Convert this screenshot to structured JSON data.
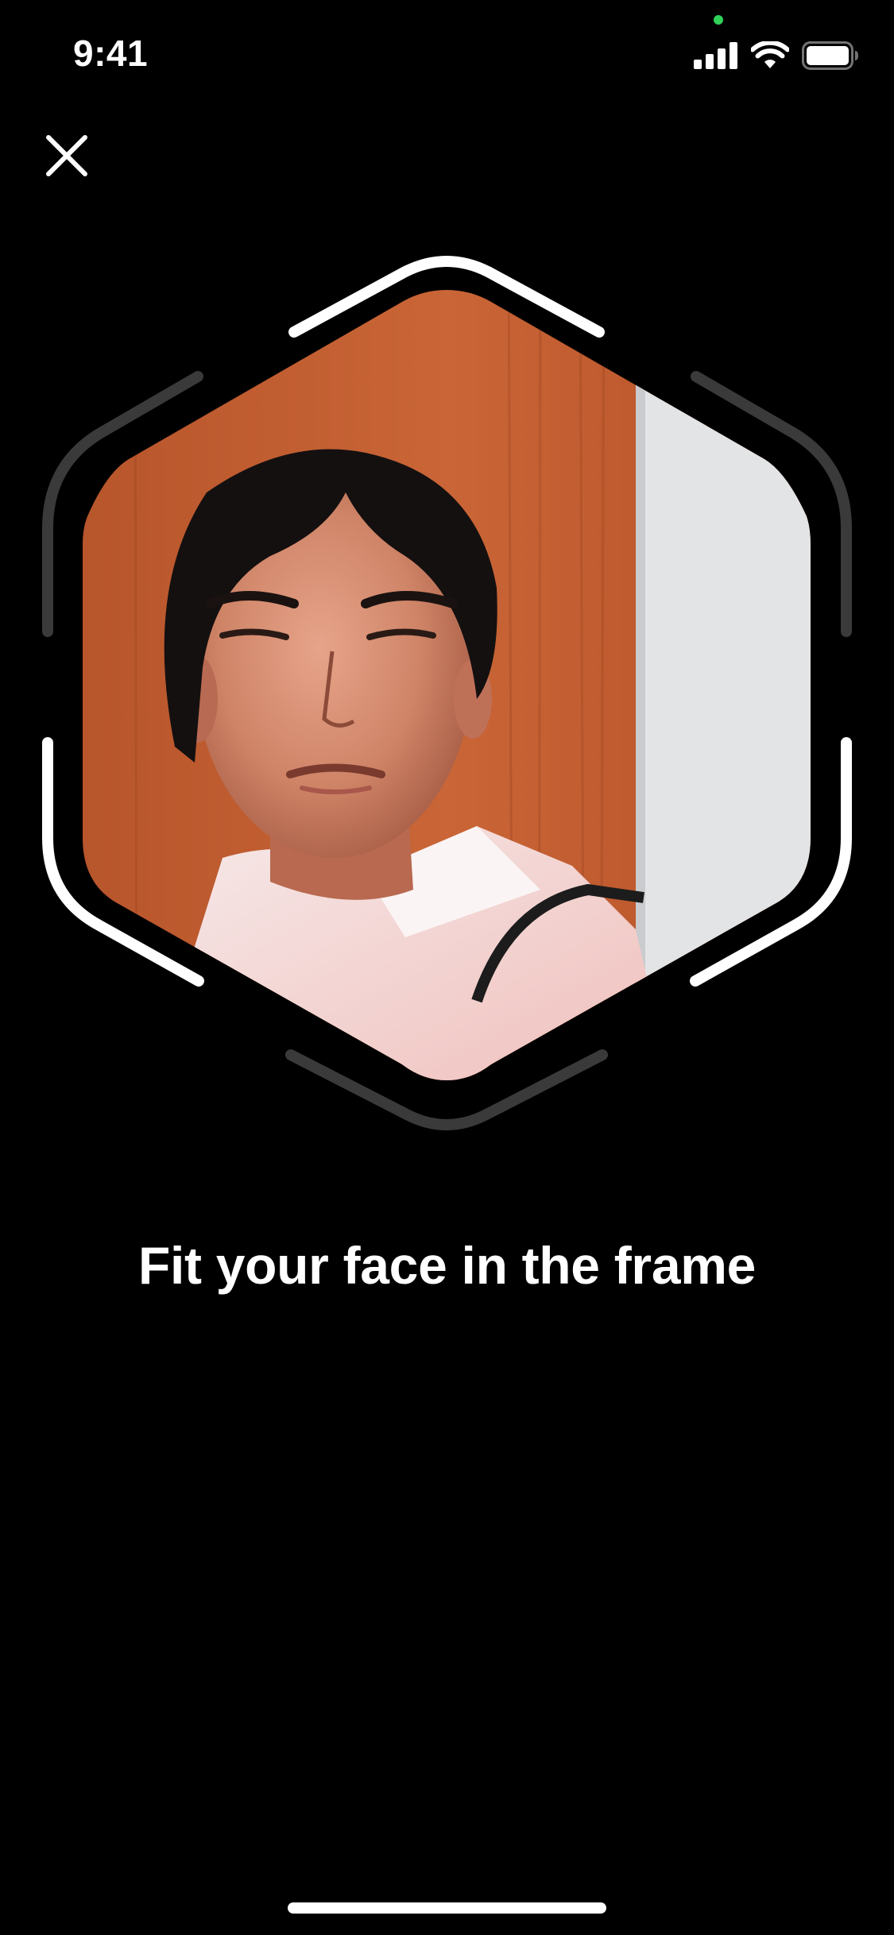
{
  "status_bar": {
    "time": "9:41"
  },
  "close_button": {
    "icon": "close-icon"
  },
  "camera": {
    "overlay_shape": "hexagon",
    "frame_color": "#ffffff",
    "inactive_frame_color": "#3a3a3a"
  },
  "instruction": {
    "text": "Fit your face in the frame"
  },
  "colors": {
    "background": "#000000",
    "text": "#ffffff",
    "privacy_dot": "#30d158"
  }
}
